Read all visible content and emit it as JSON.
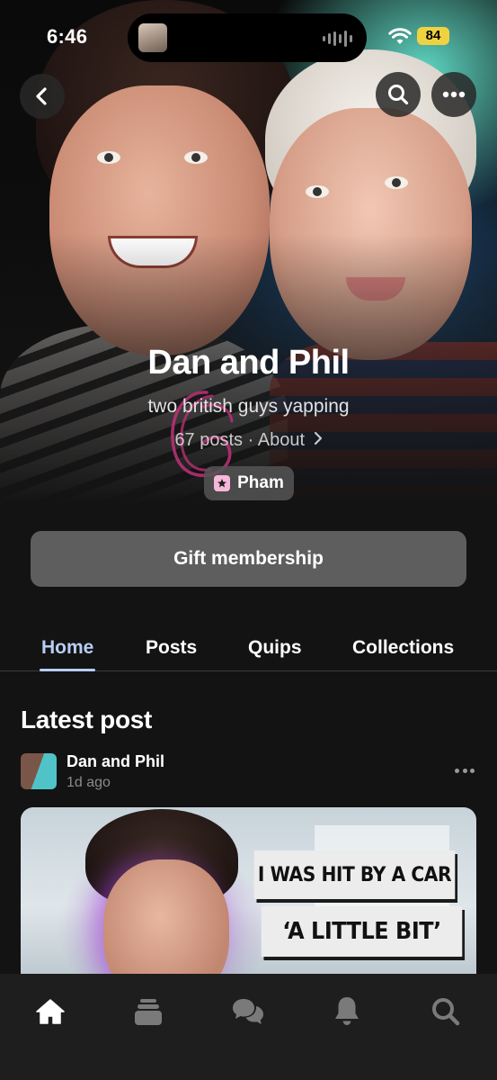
{
  "status_bar": {
    "time": "6:46",
    "battery": "84",
    "battery_color": "#f0d240"
  },
  "hero": {
    "back_icon": "chevron-left-icon",
    "search_icon": "search-icon",
    "more_icon": "ellipsis-icon",
    "creator_name": "Dan and Phil",
    "tagline": "two british guys yapping",
    "post_count": "67 posts",
    "separator": "·",
    "about_link": "About",
    "tier_name": "Pham"
  },
  "gift_button": {
    "label": "Gift membership"
  },
  "tabs": [
    {
      "label": "Home",
      "active": true
    },
    {
      "label": "Posts",
      "active": false
    },
    {
      "label": "Quips",
      "active": false
    },
    {
      "label": "Collections",
      "active": false
    }
  ],
  "latest_post": {
    "section_title": "Latest post",
    "author": "Dan and Phil",
    "time_ago": "1d ago",
    "thumbnail_caption_1": "I WAS HIT BY A CAR",
    "thumbnail_caption_2": "‘A LITTLE BIT’"
  },
  "bottom_nav": [
    {
      "icon": "home-icon",
      "active": true
    },
    {
      "icon": "library-icon",
      "active": false
    },
    {
      "icon": "chat-bubbles-icon",
      "active": false
    },
    {
      "icon": "bell-icon",
      "active": false
    },
    {
      "icon": "search-icon",
      "active": false
    }
  ],
  "colors": {
    "background": "#131313",
    "active_tab": "#b8cdf5",
    "button_gray": "#5e5e5e",
    "tier_badge": "#f5b8d8",
    "doodle": "#c0307a"
  }
}
